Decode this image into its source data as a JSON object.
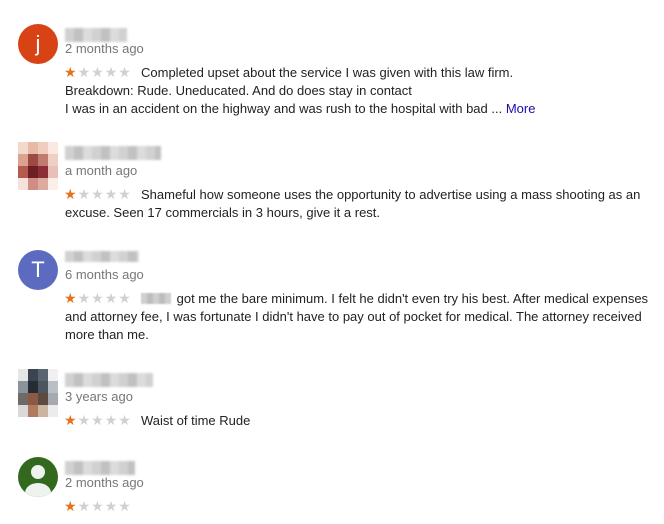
{
  "reviews": [
    {
      "avatar_letter": "j",
      "avatar_color": "#d84315",
      "time": "2 months ago",
      "rating": 1,
      "lines": [
        "Completed upset about the service I was given with this law firm.",
        "Breakdown: Rude. Uneducated. And do does stay in contact",
        "I was in an accident on the highway and was rush to the hospital with bad ..."
      ],
      "more_label": "More"
    },
    {
      "time": "a month ago",
      "rating": 1,
      "lines": [
        "Shameful how someone uses the opportunity to advertise using a mass shooting as an",
        "excuse. Seen 17 commercials in 3 hours, give it a rest."
      ]
    },
    {
      "avatar_letter": "T",
      "avatar_color": "#5c6bc0",
      "time": "6 months ago",
      "rating": 1,
      "lines": [
        "got me the bare minimum.  I felt he didn't even try his best.  After medical expenses",
        "and attorney fee, I was fortunate I didn't have to pay out of pocket for medical.  The attorney received",
        "more than me."
      ]
    },
    {
      "time": "3 years ago",
      "rating": 1,
      "lines": [
        "Waist of time Rude"
      ]
    },
    {
      "avatar_color": "#33691e",
      "time": "2 months ago",
      "rating": 1,
      "lines": []
    }
  ],
  "star_glyph": "★",
  "colors": {
    "star_filled": "#e7711b",
    "star_empty": "#d0d0d0",
    "link": "#1a0dab",
    "muted": "#777777"
  }
}
